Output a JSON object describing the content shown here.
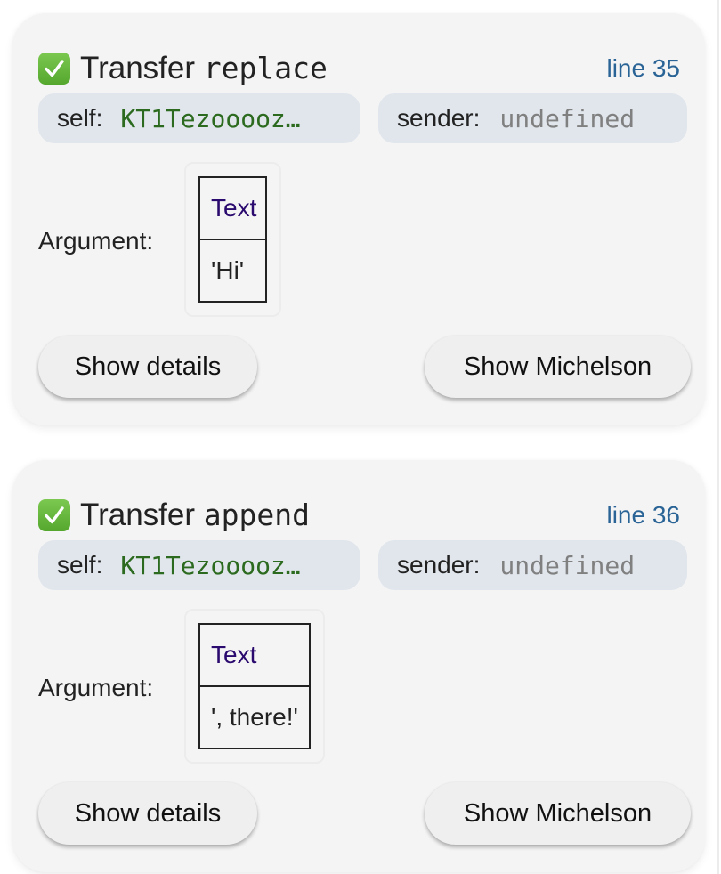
{
  "operations": [
    {
      "status_icon": "check-mark-button-icon",
      "title_prefix": "Transfer",
      "entrypoint": "replace",
      "line_link": "line 35",
      "self_label": "self:",
      "self_value": "KT1Tezooooz…",
      "sender_label": "sender:",
      "sender_value": "undefined",
      "argument_label": "Argument:",
      "argument_type": "Text",
      "argument_value": "'Hi'",
      "show_details_label": "Show details",
      "show_michelson_label": "Show Michelson"
    },
    {
      "status_icon": "check-mark-button-icon",
      "title_prefix": "Transfer",
      "entrypoint": "append",
      "line_link": "line 36",
      "self_label": "self:",
      "self_value": "KT1Tezooooz…",
      "sender_label": "sender:",
      "sender_value": "undefined",
      "argument_label": "Argument:",
      "argument_type": "Text",
      "argument_value": "', there!'",
      "show_details_label": "Show details",
      "show_michelson_label": "Show Michelson"
    }
  ],
  "colors": {
    "card_background": "#f4f4f4",
    "pill_background": "#e0e6ec",
    "address_green": "#2c6b1f",
    "line_link_blue": "#2a6496",
    "type_purple": "#2a0a6e",
    "undefined_gray": "#808080",
    "check_green": "#5cb135"
  }
}
